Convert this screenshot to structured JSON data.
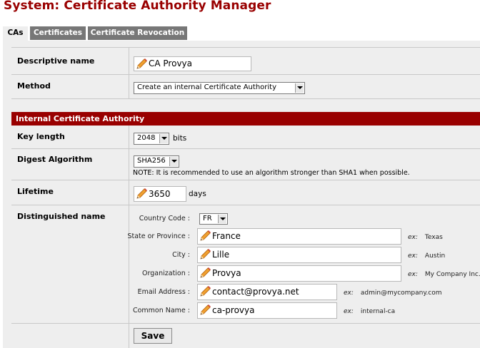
{
  "page_title": "System: Certificate Authority Manager",
  "tabs": [
    {
      "label": "CAs",
      "active": true
    },
    {
      "label": "Certificates",
      "active": false
    },
    {
      "label": "Certificate Revocation",
      "active": false
    }
  ],
  "form": {
    "descriptive_name": {
      "label": "Descriptive name",
      "value": "CA Provya"
    },
    "method": {
      "label": "Method",
      "value": "Create an internal Certificate Authority"
    },
    "section_header": "Internal Certificate Authority",
    "key_length": {
      "label": "Key length",
      "value": "2048",
      "unit": "bits"
    },
    "digest_algorithm": {
      "label": "Digest Algorithm",
      "value": "SHA256",
      "note": "NOTE: It is recommended to use an algorithm stronger than SHA1 when possible."
    },
    "lifetime": {
      "label": "Lifetime",
      "value": "3650",
      "unit": "days"
    },
    "distinguished_name": {
      "label": "Distinguished name",
      "country_code": {
        "label": "Country Code :",
        "value": "FR"
      },
      "state": {
        "label": "State or Province :",
        "value": "France",
        "ex_prefix": "ex:",
        "example": "Texas"
      },
      "city": {
        "label": "City :",
        "value": "Lille",
        "ex_prefix": "ex:",
        "example": "Austin"
      },
      "organization": {
        "label": "Organization :",
        "value": "Provya",
        "ex_prefix": "ex:",
        "example": "My Company Inc."
      },
      "email": {
        "label": "Email Address :",
        "value": "contact@provya.net",
        "ex_prefix": "ex:",
        "example": "admin@mycompany.com"
      },
      "common_name": {
        "label": "Common Name :",
        "value": "ca-provya",
        "ex_prefix": "ex:",
        "example": "internal-ca"
      }
    },
    "save_label": "Save"
  },
  "icons": {
    "field_edit": "pencil-icon"
  },
  "colors": {
    "title": "#990000",
    "section_header_bg": "#990000",
    "inactive_tab": "#777777",
    "panel_bg": "#eeeeee"
  }
}
